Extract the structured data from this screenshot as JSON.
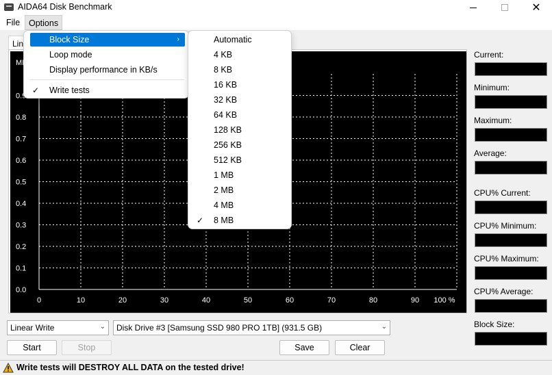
{
  "window": {
    "title": "AIDA64 Disk Benchmark"
  },
  "menubar": {
    "file": "File",
    "options": "Options"
  },
  "tab_label": "Lin",
  "chart_data": {
    "type": "line",
    "x_ticks": [
      "0",
      "10",
      "20",
      "30",
      "40",
      "50",
      "60",
      "70",
      "80",
      "90",
      "100 %"
    ],
    "y_ticks": [
      "0.0",
      "0.1",
      "0.2",
      "0.3",
      "0.4",
      "0.5",
      "0.6",
      "0.7",
      "0.8",
      "0.9"
    ],
    "y_unit_label": "MI",
    "xlim": [
      0,
      100
    ],
    "ylim": [
      0,
      1
    ],
    "grid": true,
    "series": []
  },
  "stats": {
    "current": "Current:",
    "minimum": "Minimum:",
    "maximum": "Maximum:",
    "average": "Average:",
    "cpu_current": "CPU% Current:",
    "cpu_minimum": "CPU% Minimum:",
    "cpu_maximum": "CPU% Maximum:",
    "cpu_average": "CPU% Average:",
    "block_size": "Block Size:"
  },
  "controls": {
    "test_type": "Linear Write",
    "drive": "Disk Drive #3  [Samsung SSD 980 PRO 1TB]  (931.5 GB)",
    "start": "Start",
    "stop": "Stop",
    "save": "Save",
    "clear": "Clear"
  },
  "warning": "Write tests will DESTROY ALL DATA on the tested drive!",
  "options_menu": {
    "block_size": "Block Size",
    "loop_mode": "Loop mode",
    "display_kbs": "Display performance in KB/s",
    "write_tests": "Write tests"
  },
  "block_size_menu": [
    "Automatic",
    "4 KB",
    "8 KB",
    "16 KB",
    "32 KB",
    "64 KB",
    "128 KB",
    "256 KB",
    "512 KB",
    "1 MB",
    "2 MB",
    "4 MB",
    "8 MB"
  ],
  "colors": {
    "accent": "#0078d7",
    "grid": "#ffffff",
    "plot_bg": "#000000"
  }
}
